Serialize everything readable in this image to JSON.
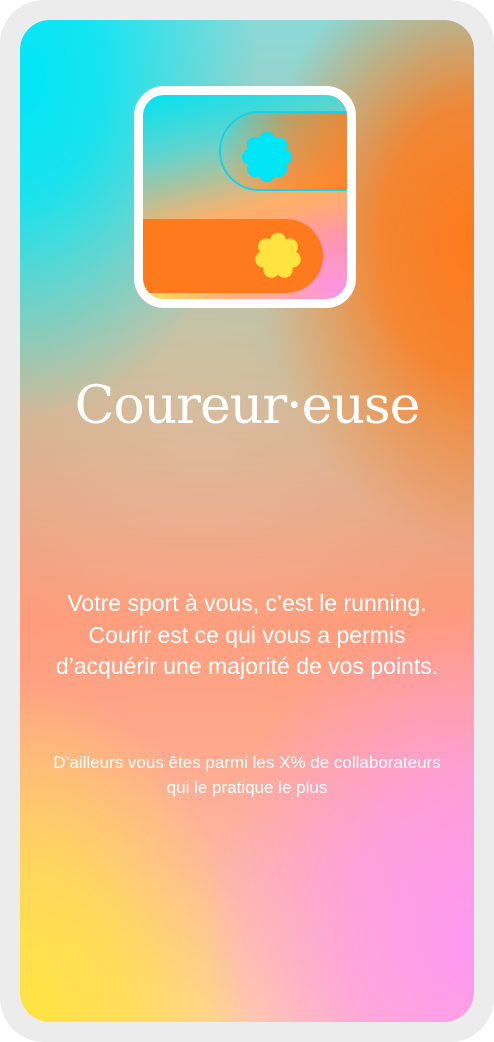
{
  "card": {
    "title": "Coureur·euse",
    "description": "Votre sport à vous, c’est le running. Courir est ce qui vous a permis d’acquérir une majorité de vos points.",
    "detail": "D’ailleurs vous êtes parmi les X% de collaborateurs qui le pratique le plus"
  },
  "illustration": {
    "icon": "running-toggle-icon",
    "top_flower_icon": "cyan-flower-icon",
    "bottom_flower_icon": "yellow-flower-icon",
    "colors": {
      "cyan": "#00e6f6",
      "orange": "#ff7a1c",
      "pink": "#ff97f2",
      "yellow": "#ffe340",
      "white": "#ffffff"
    }
  }
}
